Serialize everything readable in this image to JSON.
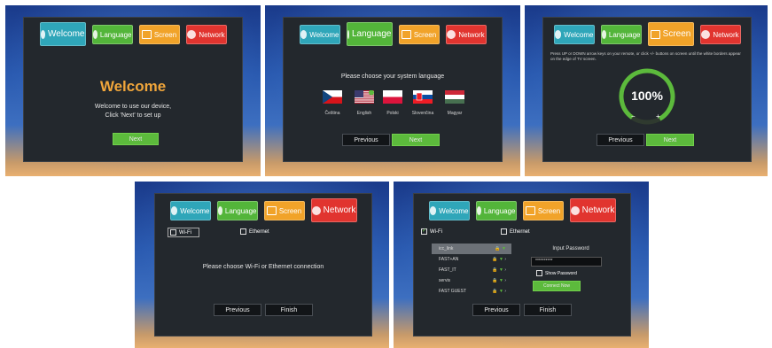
{
  "tabs": {
    "welcome": "Welcome",
    "language": "Language",
    "screen": "Screen",
    "network": "Network"
  },
  "welcome_panel": {
    "title": "Welcome",
    "message_line1": "Welcome to use our device,",
    "message_line2": "Click 'Next' to set up",
    "next": "Next"
  },
  "language_panel": {
    "prompt": "Please choose your system language",
    "languages": [
      "Čeština",
      "English",
      "Polski",
      "Slovenčina",
      "Magyar"
    ],
    "previous": "Previous",
    "next": "Next"
  },
  "screen_panel": {
    "instructions": "Press UP or DOWN arrow keys on your remote, or click +/- buttons on screen until the white borders appear on the edge of TV screen.",
    "zoom": "100%",
    "zoom_fraction": 0.82,
    "minus": "−",
    "plus": "+",
    "previous": "Previous",
    "next": "Next"
  },
  "network_panel": {
    "wifi": "Wi-Fi",
    "ethernet": "Ethernet",
    "prompt": "Please choose Wi-Fi or Ethernet connection",
    "previous": "Previous",
    "finish": "Finish"
  },
  "network_wifi_panel": {
    "wifi": "Wi-Fi",
    "ethernet": "Ethernet",
    "networks": [
      "icc_link",
      "FAST+AN",
      "FAST_IT",
      "servis",
      "FAST GUEST"
    ],
    "password_title": "Input Password",
    "password_value": "**********",
    "show_password": "Show Password",
    "connect": "Connect Now",
    "previous": "Previous",
    "finish": "Finish"
  },
  "colors": {
    "welcome": "#2fa6b9",
    "language": "#53b53a",
    "screen": "#f1a329",
    "network": "#e1342f",
    "accent": "#f1a63b"
  }
}
